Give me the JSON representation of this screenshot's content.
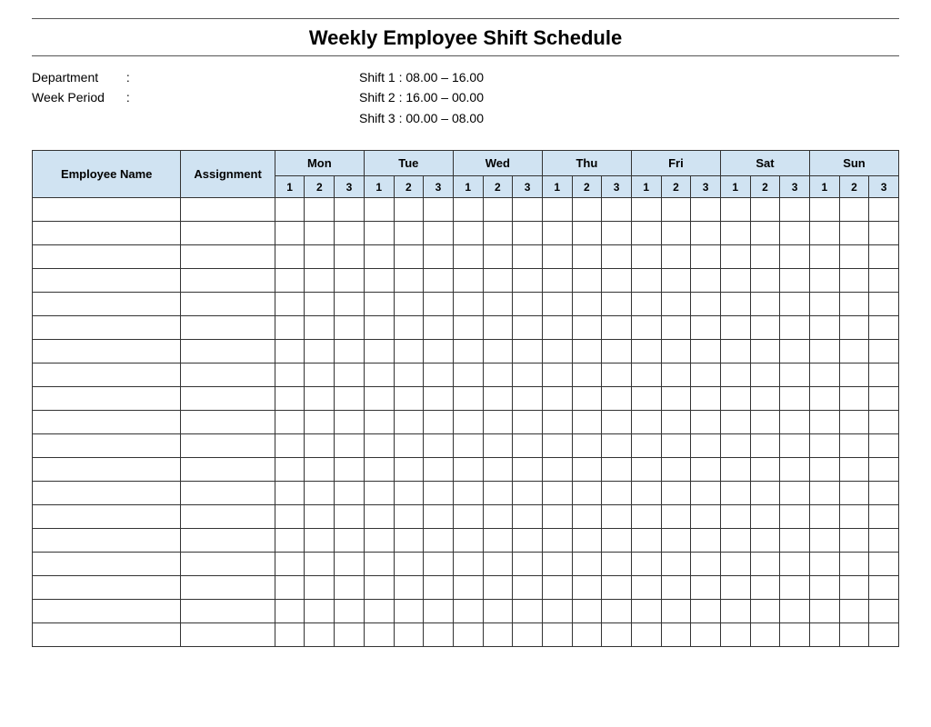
{
  "header": {
    "title": "Weekly Employee Shift Schedule"
  },
  "meta": {
    "department_label": "Department",
    "department_sep": ":",
    "week_label": "Week  Period",
    "week_sep": ":",
    "shifts": [
      {
        "label": "Shift 1",
        "sep": ":",
        "range": "08.00  –  16.00"
      },
      {
        "label": "Shift 2",
        "sep": ":",
        "range": "16.00  –  00.00"
      },
      {
        "label": "Shift 3",
        "sep": ":",
        "range": "00.00  –  08.00"
      }
    ]
  },
  "table": {
    "employee_header": "Employee Name",
    "assignment_header": "Assignment",
    "days": [
      "Mon",
      "Tue",
      "Wed",
      "Thu",
      "Fri",
      "Sat",
      "Sun"
    ],
    "slots": [
      "1",
      "2",
      "3"
    ],
    "body_rows": 19
  },
  "colors": {
    "header_bg": "#d0e3f2"
  }
}
